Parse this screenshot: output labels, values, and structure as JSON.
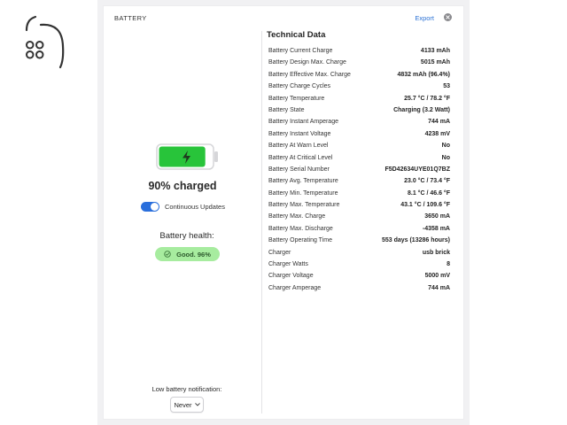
{
  "colors": {
    "accent": "#2f74d6",
    "battery_fill": "#28c43a",
    "health_bg": "#a7ec9f",
    "toggle_on": "#2a6fdc"
  },
  "icons": {
    "logo": "apple-outline-logo-icon",
    "close": "close-circle-icon",
    "battery": "battery-charging-icon",
    "health": "check-circle-icon",
    "select": "chevron-down-icon"
  },
  "header": {
    "title": "BATTERY",
    "export_label": "Export"
  },
  "status": {
    "charge_label": "90% charged",
    "charge_level": 0.9,
    "continuous_updates_label": "Continuous Updates",
    "continuous_updates_on": true,
    "health_heading": "Battery health:",
    "health_value": "Good. 96%",
    "notification_label": "Low battery notification:",
    "notification_value": "Never"
  },
  "technical": {
    "title": "Technical Data",
    "rows": [
      {
        "key": "Battery Current Charge",
        "value": "4133 mAh"
      },
      {
        "key": "Battery Design Max. Charge",
        "value": "5015 mAh"
      },
      {
        "key": "Battery Effective Max. Charge",
        "value": "4832 mAh (96.4%)"
      },
      {
        "key": "Battery Charge Cycles",
        "value": "53"
      },
      {
        "key": "Battery Temperature",
        "value": "25.7 °C / 78.2 °F"
      },
      {
        "key": "Battery State",
        "value": "Charging (3.2 Watt)"
      },
      {
        "key": "Battery Instant Amperage",
        "value": "744 mA"
      },
      {
        "key": "Battery Instant Voltage",
        "value": "4238 mV"
      },
      {
        "key": "Battery At Warn Level",
        "value": "No"
      },
      {
        "key": "Battery At Critical Level",
        "value": "No"
      },
      {
        "key": "Battery Serial Number",
        "value": "F5D42634UYE01Q7BZ"
      },
      {
        "key": "Battery Avg. Temperature",
        "value": "23.0 °C / 73.4 °F"
      },
      {
        "key": "Battery Min. Temperature",
        "value": "8.1 °C / 46.6 °F"
      },
      {
        "key": "Battery Max. Temperature",
        "value": "43.1 °C / 109.6 °F"
      },
      {
        "key": "Battery Max. Charge",
        "value": "3650 mA"
      },
      {
        "key": "Battery Max. Discharge",
        "value": "-4358 mA"
      },
      {
        "key": "Battery Operating Time",
        "value": "553 days (13286 hours)"
      },
      {
        "key": "Charger",
        "value": "usb brick"
      },
      {
        "key": "Charger Watts",
        "value": "8"
      },
      {
        "key": "Charger Voltage",
        "value": "5000 mV"
      },
      {
        "key": "Charger Amperage",
        "value": "744 mA"
      }
    ]
  }
}
